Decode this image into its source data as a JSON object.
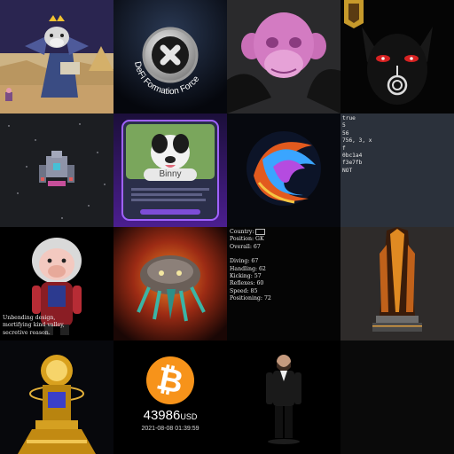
{
  "gallery": {
    "tiles": [
      {
        "name": "desert-dragon-scene"
      },
      {
        "name": "defi-force-coin",
        "ring_text": "DeFi Formation Force"
      },
      {
        "name": "pink-monkey-head"
      },
      {
        "name": "black-cat-mask"
      },
      {
        "name": "pixel-spaceship"
      },
      {
        "name": "binny-dog-card",
        "card_name": "Binny"
      },
      {
        "name": "swirl-sphere"
      },
      {
        "name": "metadata-text-card",
        "lines": [
          "true",
          "5",
          "56",
          "756, 3, x",
          "f",
          "0bc1a4",
          "f3e7fb",
          "NOT"
        ]
      },
      {
        "name": "astronaut-figure",
        "caption": [
          "Unbending design,",
          "mortifying kind valley,",
          "secretive reason."
        ]
      },
      {
        "name": "fire-creature"
      },
      {
        "name": "player-stats-card",
        "country_label": "Country:",
        "position": "Position: GK",
        "overall": "Overall: 67",
        "stats": [
          "Diving: 67",
          "Handling: 62",
          "Kicking: 57",
          "Reflexes: 60",
          "Speed: 85",
          "Positioning: 72"
        ]
      },
      {
        "name": "gold-trophy-tower"
      },
      {
        "name": "gold-reactor-trophy"
      },
      {
        "name": "bitcoin-price-card",
        "symbol": "₿",
        "price": "43986",
        "currency": "USD",
        "timestamp": "2021-08-08 01:39:59"
      },
      {
        "name": "gentleman-figure"
      }
    ]
  },
  "colors": {
    "bitcoin_orange": "#f7931a",
    "stats_bg": "#050505",
    "metadata_bg": "#2b313b"
  }
}
